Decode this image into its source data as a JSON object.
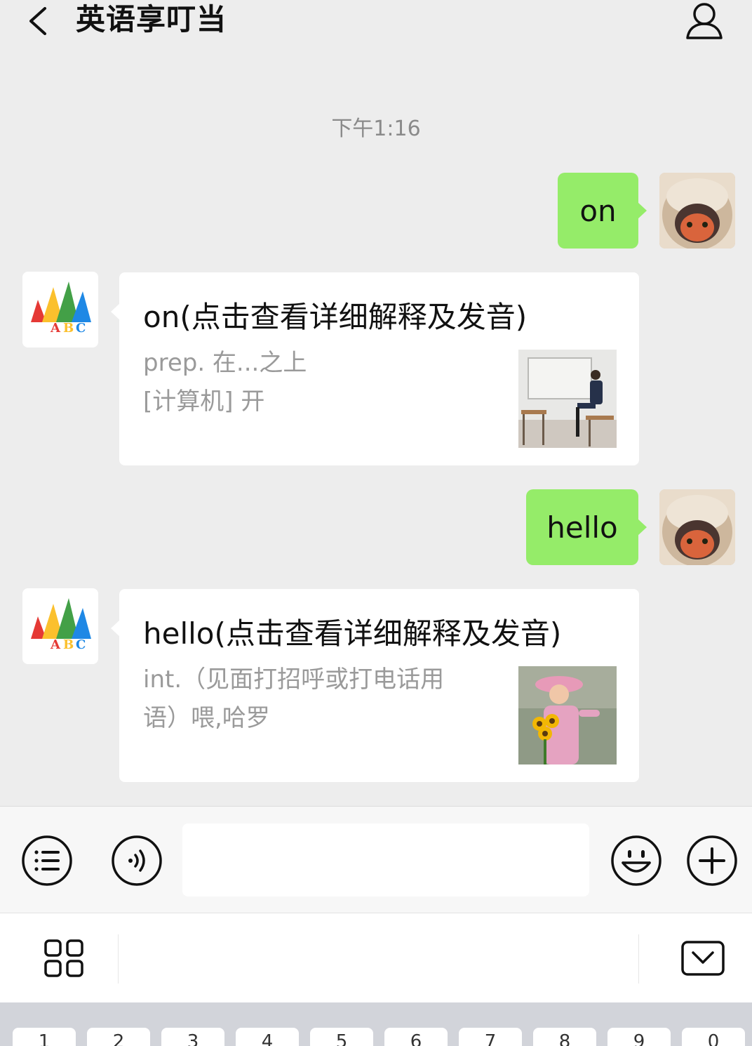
{
  "header": {
    "title": "英语享叮当"
  },
  "timestamp": "下午1:16",
  "messages": [
    {
      "direction": "out",
      "text": "on"
    },
    {
      "direction": "in",
      "title": "on(点击查看详细解释及发音)",
      "lines": [
        "prep. 在...之上",
        "[计算机] 开"
      ]
    },
    {
      "direction": "out",
      "text": "hello"
    },
    {
      "direction": "in",
      "title": "hello(点击查看详细解释及发音)",
      "lines": [
        "int.（见面打招呼或打电话用",
        "语）喂,哈罗"
      ]
    }
  ],
  "input": {
    "placeholder": ""
  },
  "keyboard": {
    "keys": [
      "1",
      "2",
      "3",
      "4",
      "5",
      "6",
      "7",
      "8",
      "9",
      "0"
    ]
  },
  "colors": {
    "background": "#ededed",
    "outgoing_bubble": "#95ec69",
    "incoming_bubble": "#ffffff",
    "secondary_text": "#9a9a9a"
  },
  "icons": {
    "back": "chevron-left-icon",
    "profile": "person-icon",
    "menu": "list-icon",
    "voice": "voice-icon",
    "emoji": "emoji-icon",
    "add": "plus-icon",
    "apps": "grid-icon",
    "collapse": "chevron-down-box-icon"
  }
}
